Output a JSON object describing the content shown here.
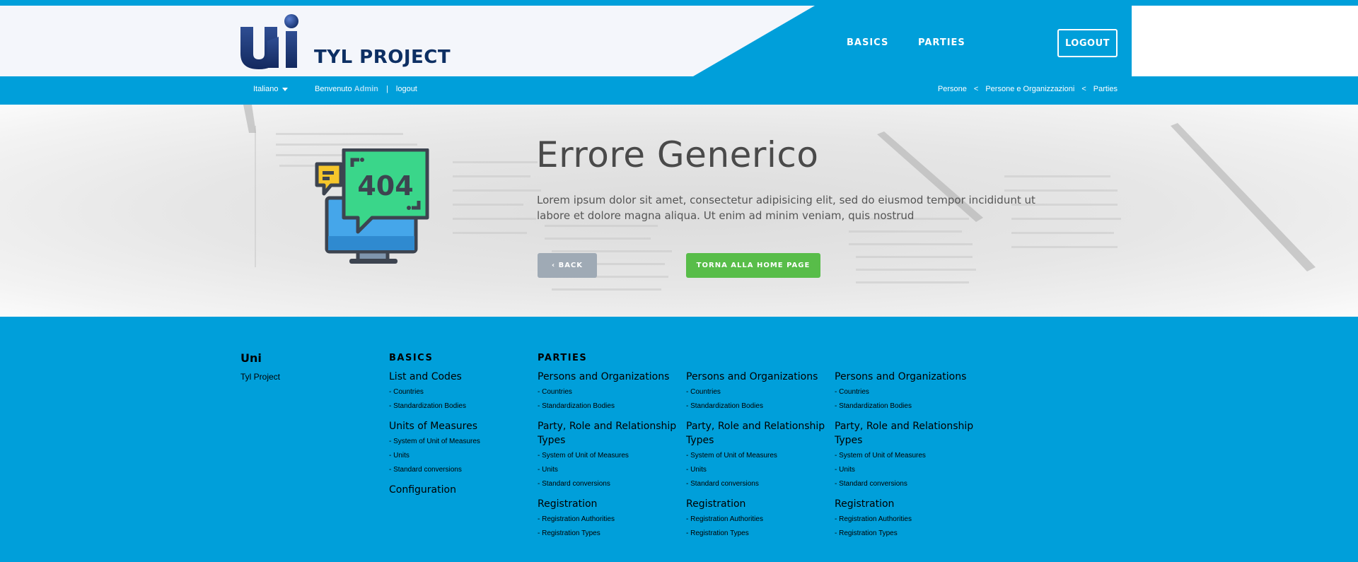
{
  "header": {
    "logo_mark_text": "Uni",
    "logo_text": "TYL PROJECT",
    "nav": [
      {
        "label": "BASICS"
      },
      {
        "label": "PARTIES"
      }
    ],
    "logout_label": "LOGOUT"
  },
  "subbar": {
    "language": "Italiano",
    "welcome": "Benvenuto",
    "user": "Admin",
    "separator": "|",
    "logout": "logout",
    "breadcrumb": [
      "Persone",
      "Persone e Organizzazioni",
      "Parties"
    ],
    "breadcrumb_sep": "<"
  },
  "hero": {
    "illustration_text": "404",
    "title": "Errore Generico",
    "text": "Lorem ipsum dolor sit amet, consectetur adipisicing elit, sed do eiusmod tempor incididunt ut labore et dolore magna aliqua. Ut enim ad minim veniam, quis nostrud",
    "back_label": "‹ BACK",
    "home_label": "TORNA ALLA HOME PAGE"
  },
  "footer": {
    "brand": "Uni",
    "brand_sub": "Tyl Project",
    "columns": [
      {
        "heading": "BASICS",
        "groups": [
          {
            "title": "List and Codes",
            "items": [
              "- Countries",
              "- Standardization Bodies"
            ]
          },
          {
            "title": "Units of Measures",
            "items": [
              "- System of Unit of Measures",
              "- Units",
              "- Standard conversions"
            ]
          },
          {
            "title": "Configuration",
            "items": []
          }
        ]
      },
      {
        "heading": "PARTIES",
        "groups": [
          {
            "title": "Persons and Organizations",
            "items": [
              "- Countries",
              "- Standardization Bodies"
            ]
          },
          {
            "title": "Party, Role and Relationship Types",
            "items": [
              "- System of Unit of Measures",
              "- Units",
              "- Standard conversions"
            ]
          },
          {
            "title": "Registration",
            "items": [
              "- Registration Authorities",
              "- Registration Types"
            ]
          }
        ]
      },
      {
        "heading": "",
        "groups": [
          {
            "title": "Persons and Organizations",
            "items": [
              "- Countries",
              "- Standardization Bodies"
            ]
          },
          {
            "title": "Party, Role and Relationship Types",
            "items": [
              "- System of Unit of Measures",
              "- Units",
              "- Standard conversions"
            ]
          },
          {
            "title": "Registration",
            "items": [
              "- Registration Authorities",
              "- Registration Types"
            ]
          }
        ]
      },
      {
        "heading": "",
        "groups": [
          {
            "title": "Persons and Organizations",
            "items": [
              "- Countries",
              "- Standardization Bodies"
            ]
          },
          {
            "title": "Party, Role and Relationship Types",
            "items": [
              "- System of Unit of Measures",
              "- Units",
              "- Standard conversions"
            ]
          },
          {
            "title": "Registration",
            "items": [
              "- Registration Authorities",
              "- Registration Types"
            ]
          }
        ]
      }
    ]
  },
  "colors": {
    "primary_blue": "#009fda",
    "navy": "#0d2f63",
    "green": "#58bd49",
    "grey_button": "#9faab5",
    "screen_green": "#3ad68a",
    "bubble_yellow": "#f6c62b"
  },
  "icons": [
    "logo-mark",
    "dropdown-caret",
    "monitor-404-illustration",
    "chevron-left-icon"
  ]
}
